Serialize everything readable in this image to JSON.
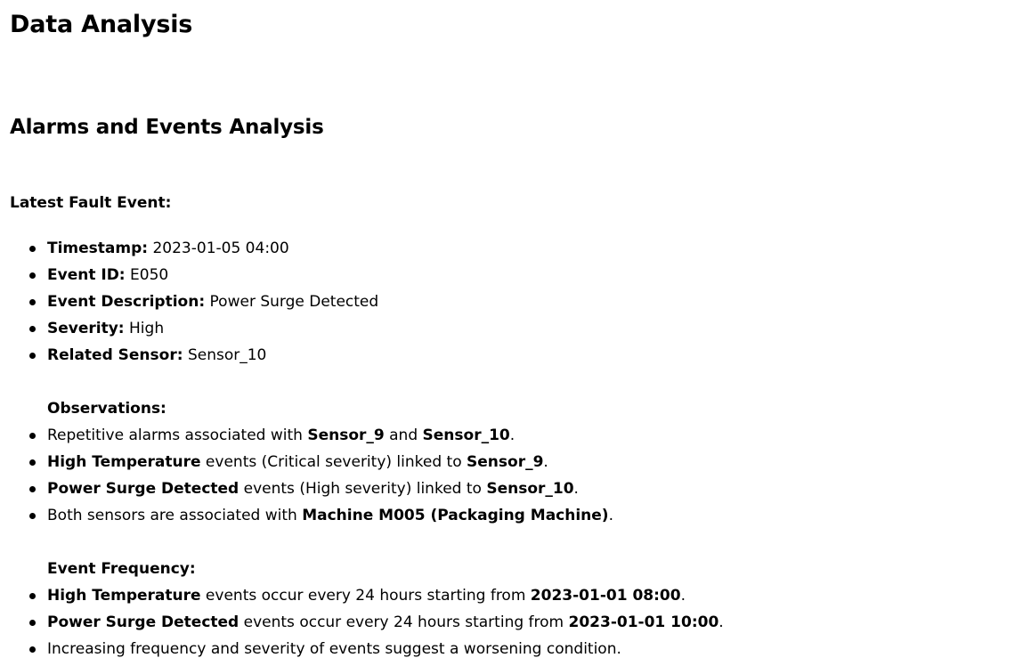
{
  "title": "Data Analysis",
  "section_title": "Alarms and Events Analysis",
  "latest_fault": {
    "heading": "Latest Fault Event:",
    "items": [
      {
        "label": "Timestamp:",
        "value": "2023-01-05 04:00"
      },
      {
        "label": "Event ID:",
        "value": "E050"
      },
      {
        "label": "Event Description:",
        "value": "Power Surge Detected"
      },
      {
        "label": "Severity:",
        "value": "High"
      },
      {
        "label": "Related Sensor:",
        "value": "Sensor_10"
      }
    ]
  },
  "observations": {
    "heading": "Observations:",
    "items": [
      {
        "p1": "Repetitive alarms associated with ",
        "b1": "Sensor_9",
        "p2": " and ",
        "b2": "Sensor_10",
        "p3": "."
      },
      {
        "b1": "High Temperature",
        "p1": " events (Critical severity) linked to ",
        "b2": "Sensor_9",
        "p2": "."
      },
      {
        "b1": "Power Surge Detected",
        "p1": " events (High severity) linked to ",
        "b2": "Sensor_10",
        "p2": "."
      },
      {
        "p1": "Both sensors are associated with ",
        "b1": "Machine M005 (Packaging Machine)",
        "p2": "."
      }
    ]
  },
  "event_frequency": {
    "heading": "Event Frequency:",
    "items": [
      {
        "b1": "High Temperature",
        "p1": " events occur every 24 hours starting from ",
        "b2": "2023-01-01 08:00",
        "p2": "."
      },
      {
        "b1": "Power Surge Detected",
        "p1": " events occur every 24 hours starting from ",
        "b2": "2023-01-01 10:00",
        "p2": "."
      },
      {
        "p1": "Increasing frequency and severity of events suggest a worsening condition."
      }
    ]
  }
}
